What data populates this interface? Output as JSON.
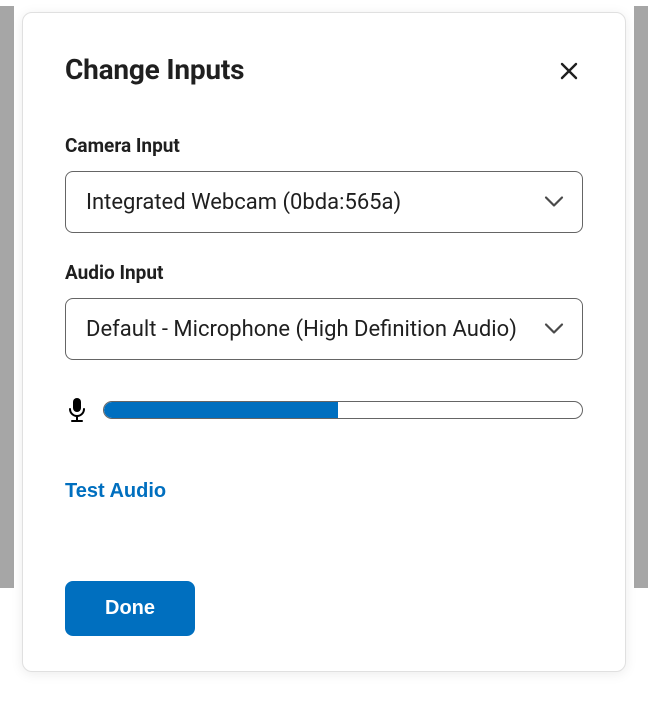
{
  "modal": {
    "title": "Change Inputs",
    "camera": {
      "label": "Camera Input",
      "selected": "Integrated Webcam (0bda:565a)"
    },
    "audio": {
      "label": "Audio Input",
      "selected": "Default - Microphone (High Definition Audio)",
      "level_percent": 49
    },
    "test_audio_label": "Test Audio",
    "done_label": "Done"
  },
  "colors": {
    "primary": "#006fbf"
  }
}
